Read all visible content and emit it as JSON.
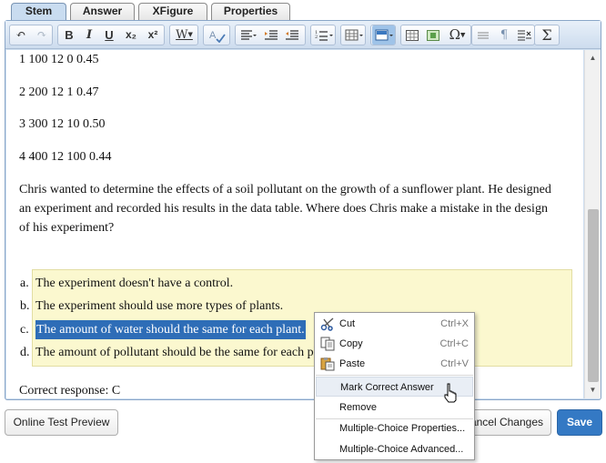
{
  "tabs": [
    {
      "label": "Stem",
      "active": true
    },
    {
      "label": "Answer",
      "active": false
    },
    {
      "label": "XFigure",
      "active": false
    },
    {
      "label": "Properties",
      "active": false
    }
  ],
  "toolbar": {
    "undo": "↶",
    "redo": "↷",
    "bold": "B",
    "italic": "I",
    "underline": "U",
    "subscript": "x₂",
    "superscript": "x²",
    "font": "W",
    "omega": "Ω",
    "pilcrow": "¶",
    "sigma": "Σ"
  },
  "content": {
    "lines": [
      "1 100 12 0 0.45",
      "2 200 12 1 0.47",
      "3 300 12 10 0.50",
      "4 400 12 100 0.44"
    ],
    "question": [
      "Chris wanted to determine the effects of a soil pollutant on the growth of a sunflower plant. He designed",
      "an experiment and recorded his results in the data table. Where does Chris make a mistake in the design",
      "of his experiment?"
    ],
    "choices": [
      {
        "letter": "a.",
        "text": "The experiment doesn't have a control."
      },
      {
        "letter": "b.",
        "text": "The experiment should use more types of plants."
      },
      {
        "letter": "c.",
        "text": "The amount of water should the same for each plant."
      },
      {
        "letter": "d.",
        "text": "The amount of pollutant should be the same for each pl"
      }
    ],
    "correct_response": "Correct response: C"
  },
  "buttons": {
    "preview": "Online Test Preview",
    "cancel": "ancel Changes",
    "save": "Save"
  },
  "context_menu": {
    "cut": {
      "label": "Cut",
      "shortcut": "Ctrl+X"
    },
    "copy": {
      "label": "Copy",
      "shortcut": "Ctrl+C"
    },
    "paste": {
      "label": "Paste",
      "shortcut": "Ctrl+V"
    },
    "mark_correct": "Mark Correct Answer",
    "remove": "Remove",
    "mc_properties": "Multiple-Choice Properties...",
    "mc_advanced": "Multiple-Choice Advanced..."
  },
  "colors": {
    "selection": "#2e6db7",
    "choice_background": "#fbf8cf",
    "primary_button": "#3479c4"
  }
}
